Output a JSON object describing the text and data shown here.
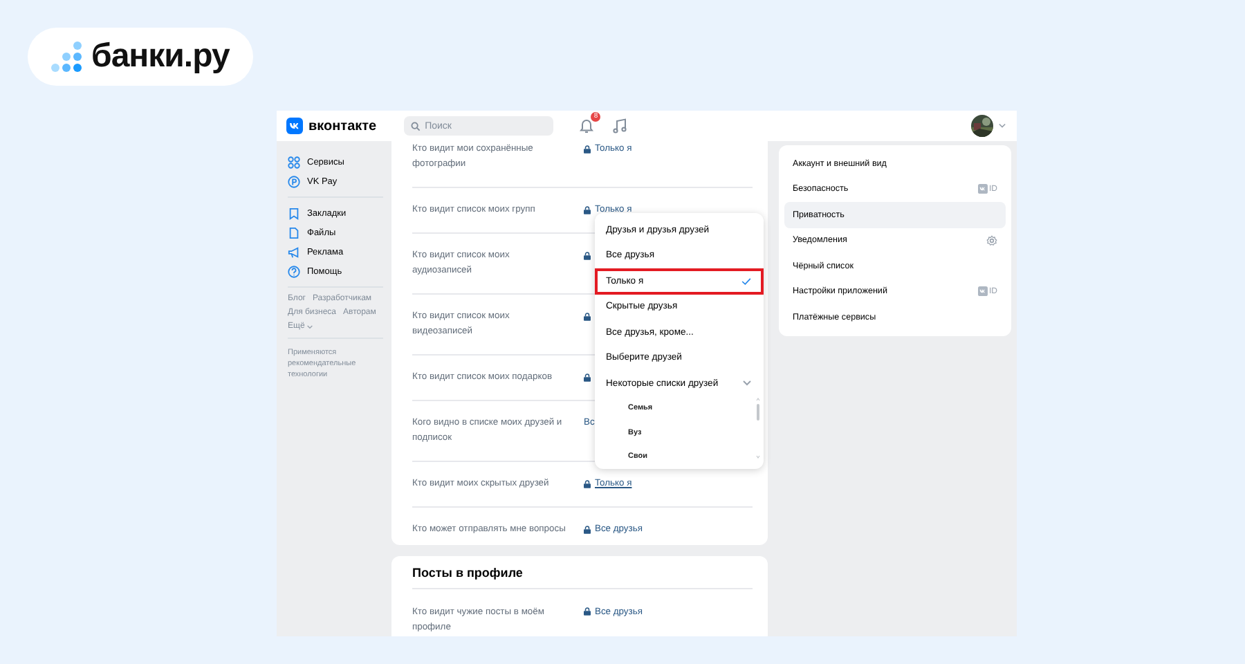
{
  "brand": {
    "name": "банки.ру"
  },
  "header": {
    "logo_text": "вконтакте",
    "search": {
      "placeholder": "Поиск"
    },
    "notifications_badge": "8"
  },
  "sidebar": {
    "items": [
      {
        "label": "Сервисы"
      },
      {
        "label": "VK Pay"
      },
      {
        "label": "Закладки"
      },
      {
        "label": "Файлы"
      },
      {
        "label": "Реклама"
      },
      {
        "label": "Помощь"
      }
    ],
    "footer_links": [
      "Блог",
      "Разработчикам",
      "Для бизнеса",
      "Авторам",
      "Ещё"
    ],
    "note": "Применяются рекомендательные технологии"
  },
  "privacy_rows": [
    {
      "label": "Кто видит мои сохранённые фотографии",
      "lock": true,
      "value": "Только я",
      "underlined": false
    },
    {
      "label": "Кто видит список моих групп",
      "lock": true,
      "value": "Только я",
      "underlined": false
    },
    {
      "label": "Кто видит список моих аудиозаписей",
      "lock": true
    },
    {
      "label": "Кто видит список моих видеозаписей",
      "lock": true
    },
    {
      "label": "Кто видит список моих подарков",
      "lock": true
    },
    {
      "label": "Кого видно в списке моих друзей и подписок",
      "lock": false,
      "value": "Вс",
      "underlined": false
    },
    {
      "label": "Кто видит моих скрытых друзей",
      "lock": true,
      "value": "Только я",
      "underlined": true
    },
    {
      "label": "Кто может отправлять мне вопросы",
      "lock": true,
      "value": "Все друзья",
      "underlined": false
    }
  ],
  "posts_section": {
    "title": "Посты в профиле",
    "rows": [
      {
        "label": "Кто видит чужие посты в моём профиле",
        "lock": true,
        "value": "Все друзья",
        "underlined": false
      }
    ]
  },
  "dropdown": {
    "items": [
      {
        "kind": "option",
        "label": "Друзья и друзья друзей",
        "selected": false,
        "highlighted": false
      },
      {
        "kind": "option",
        "label": "Все друзья",
        "selected": false,
        "highlighted": false
      },
      {
        "kind": "option",
        "label": "Только я",
        "selected": true,
        "highlighted": true
      },
      {
        "kind": "option",
        "label": "Скрытые друзья",
        "selected": false,
        "highlighted": false
      },
      {
        "kind": "option",
        "label": "Все друзья, кроме...",
        "selected": false,
        "highlighted": false
      },
      {
        "kind": "option",
        "label": "Выберите друзей",
        "selected": false,
        "highlighted": false
      },
      {
        "kind": "group",
        "label": "Некоторые списки друзей",
        "selected": false,
        "highlighted": false
      },
      {
        "kind": "sub",
        "label": "Семья",
        "selected": false,
        "highlighted": false
      },
      {
        "kind": "sub",
        "label": "Вуз",
        "selected": false,
        "highlighted": false
      },
      {
        "kind": "sub",
        "label": "Свои",
        "selected": false,
        "highlighted": false
      }
    ]
  },
  "settings_menu": {
    "items": [
      {
        "kind": "plain",
        "label": "Аккаунт и внешний вид",
        "selected": false
      },
      {
        "kind": "vkid",
        "label": "Безопасность",
        "selected": false,
        "badge": "ID"
      },
      {
        "kind": "plain",
        "label": "Приватность",
        "selected": true
      },
      {
        "kind": "gear",
        "label": "Уведомления",
        "selected": false
      },
      {
        "kind": "plain",
        "label": "Чёрный список",
        "selected": false
      },
      {
        "kind": "vkid",
        "label": "Настройки приложений",
        "selected": false,
        "badge": "ID"
      },
      {
        "kind": "plain",
        "label": "Платёжные сервисы",
        "selected": false
      }
    ]
  }
}
